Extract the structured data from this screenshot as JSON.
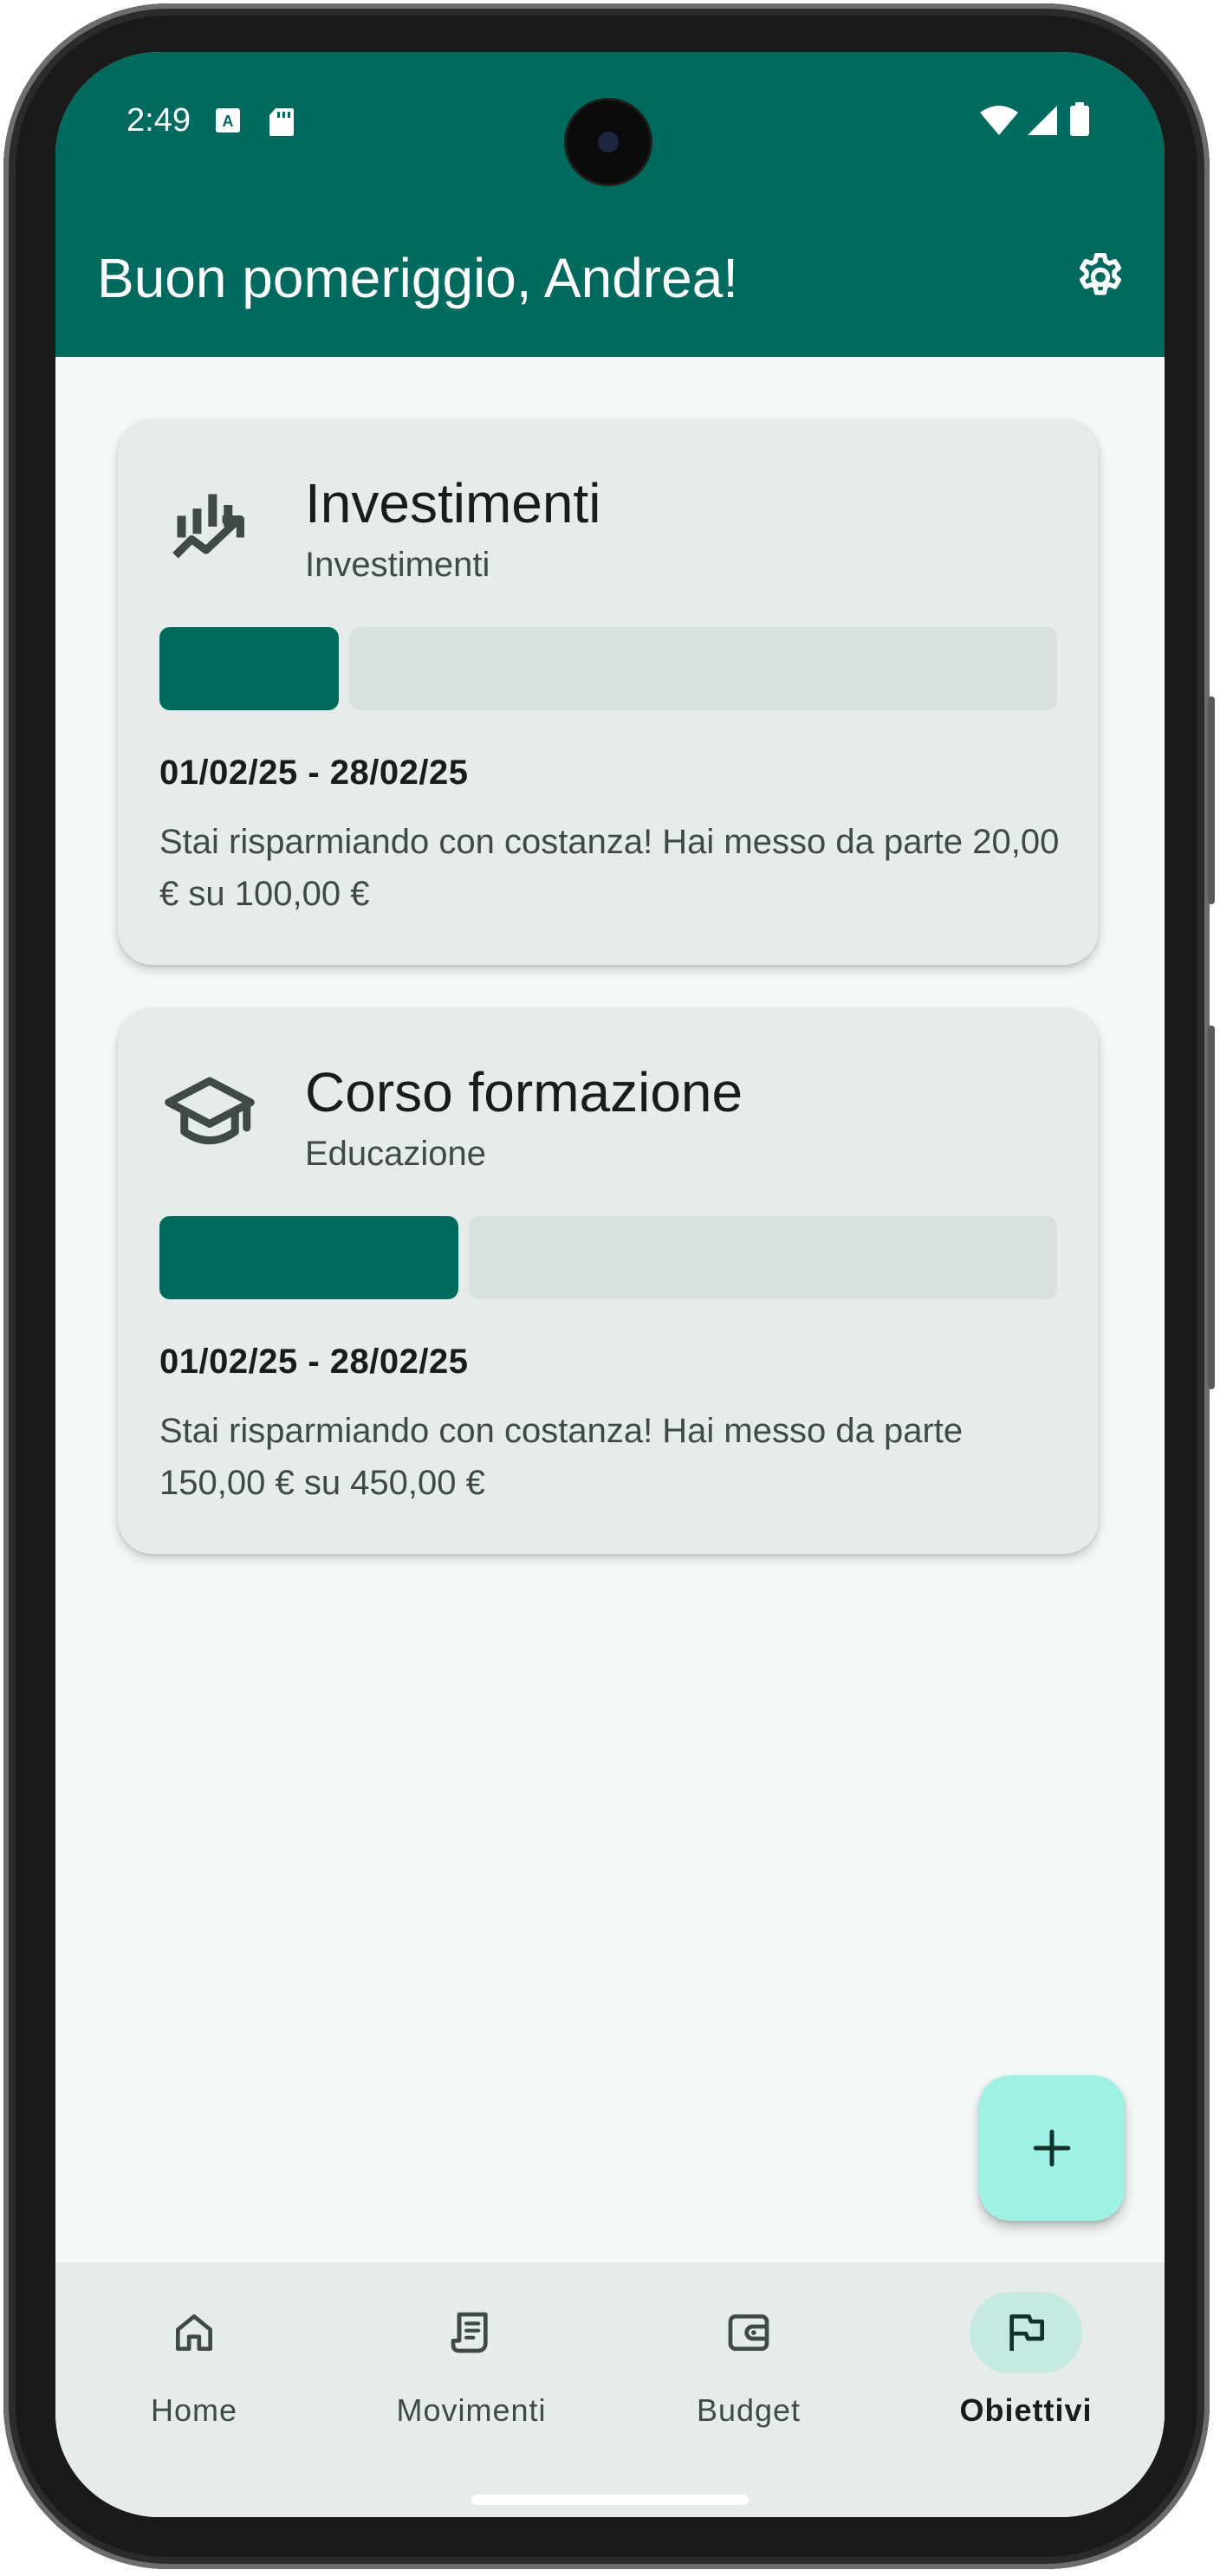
{
  "status_bar": {
    "time": "2:49"
  },
  "header": {
    "greeting": "Buon pomeriggio, Andrea!",
    "settings_icon": "gear-icon",
    "background": "#006a5f"
  },
  "goals": [
    {
      "title": "Investimenti",
      "category": "Investimenti",
      "icon": "investment-chart-icon",
      "progress": 0.2,
      "dates": "01/02/25 - 28/02/25",
      "message": "Stai risparmiando con costanza! Hai messo da parte 20,00 € su 100,00 €"
    },
    {
      "title": "Corso formazione",
      "category": "Educazione",
      "icon": "graduation-cap-icon",
      "progress": 0.3333,
      "dates": "01/02/25 - 28/02/25",
      "message": "Stai risparmiando con costanza! Hai messo da parte 150,00 € su 450,00 €"
    }
  ],
  "fab": {
    "icon": "plus-icon",
    "color": "#9ef2e3"
  },
  "nav": {
    "items": [
      {
        "label": "Home",
        "icon": "home-icon",
        "active": false
      },
      {
        "label": "Movimenti",
        "icon": "receipt-icon",
        "active": false
      },
      {
        "label": "Budget",
        "icon": "wallet-icon",
        "active": false
      },
      {
        "label": "Obiettivi",
        "icon": "flag-icon",
        "active": true
      }
    ]
  },
  "colors": {
    "primary": "#006a5f",
    "progress_track": "#d8e1de",
    "card_background": "#e6ecea",
    "active_nav_pill": "#c6e9e1"
  }
}
